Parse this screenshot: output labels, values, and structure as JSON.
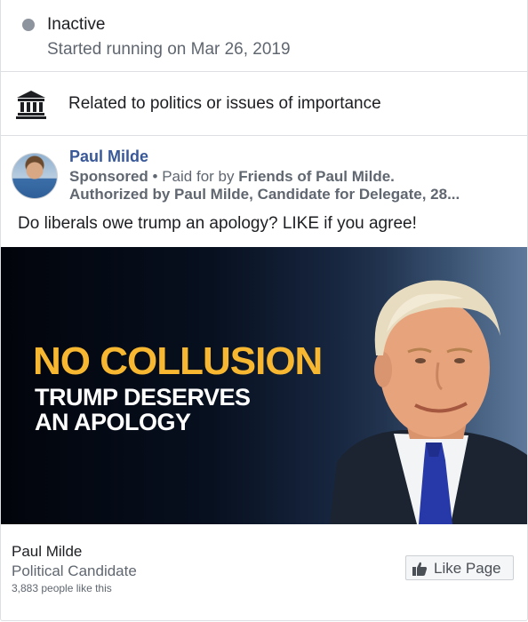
{
  "status": {
    "label": "Inactive",
    "started": "Started running on Mar 26, 2019",
    "dot_color": "#8d949e"
  },
  "category": {
    "icon": "government-building-icon",
    "text": "Related to politics or issues of importance"
  },
  "ad": {
    "page_name": "Paul Milde",
    "sponsored_label": "Sponsored",
    "separator": "•",
    "paid_for_prefix": "Paid for by",
    "payer": "Friends of Paul Milde.",
    "disclaimer": "Authorized by Paul Milde, Candidate for Delegate, 28...",
    "text": "Do liberals owe trump an apology? LIKE if you agree!",
    "creative": {
      "headline": "NO COLLUSION",
      "subline_1": "TRUMP DESERVES",
      "subline_2": "AN APOLOGY",
      "headline_color": "#f7b731"
    }
  },
  "footer": {
    "page_name": "Paul Milde",
    "page_category": "Political Candidate",
    "likes": "3,883 people like this",
    "like_button_label": "Like Page",
    "like_button_icon": "thumbs-up-icon"
  },
  "colors": {
    "link_blue": "#385898",
    "secondary_text": "#606770",
    "border": "#dddfe2"
  }
}
